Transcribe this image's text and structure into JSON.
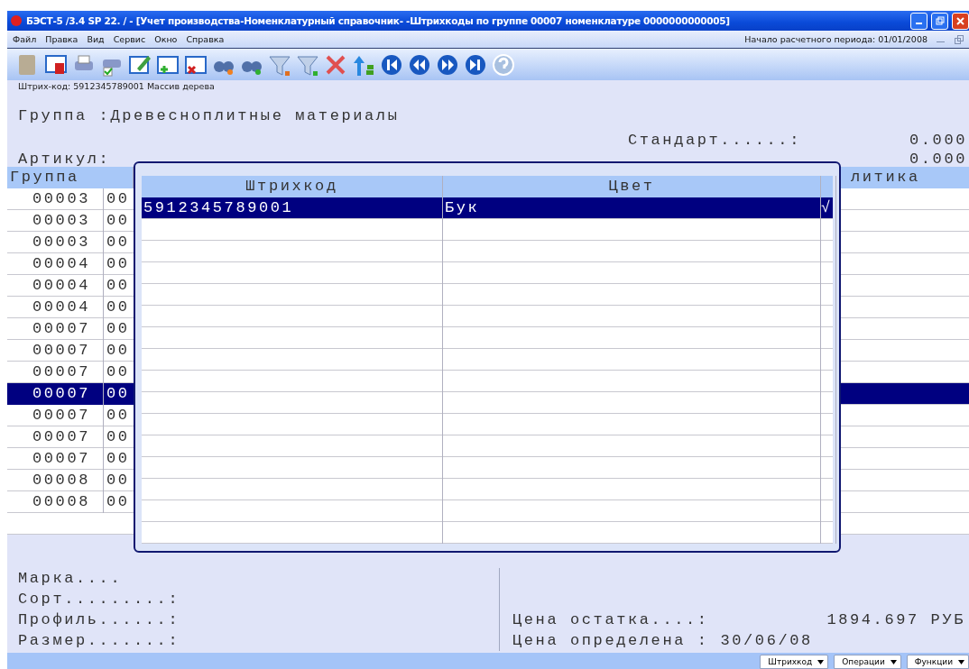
{
  "window": {
    "title": "БЭСТ-5 /3.4 SP 22. / - [Учет производства-Номенклатурный справочник- -Штрихкоды по группе 00007 номенклатуре 0000000000005]"
  },
  "menu": [
    "Файл",
    "Правка",
    "Вид",
    "Сервис",
    "Окно",
    "Справка"
  ],
  "period": "Начало расчетного периода: 01/01/2008",
  "hint": "Штрих-код: 5912345789001 Массив дерева",
  "header": {
    "group": "Группа :Древесноплитные материалы",
    "standard_label": "Стандарт......:",
    "standard_value": "0.000",
    "article_label": "Артикул:",
    "article_value": "0.000"
  },
  "table": {
    "column_1": "Группа",
    "column_3": "литика",
    "rows": [
      {
        "group": "00003",
        "column_2": "00",
        "selected": false
      },
      {
        "group": "00003",
        "column_2": "00",
        "selected": false
      },
      {
        "group": "00003",
        "column_2": "00",
        "selected": false
      },
      {
        "group": "00004",
        "column_2": "00",
        "selected": false
      },
      {
        "group": "00004",
        "column_2": "00",
        "selected": false
      },
      {
        "group": "00004",
        "column_2": "00",
        "selected": false
      },
      {
        "group": "00007",
        "column_2": "00",
        "selected": false
      },
      {
        "group": "00007",
        "column_2": "00",
        "selected": false
      },
      {
        "group": "00007",
        "column_2": "00",
        "selected": false
      },
      {
        "group": "00007",
        "column_2": "00",
        "selected": true
      },
      {
        "group": "00007",
        "column_2": "00",
        "selected": false
      },
      {
        "group": "00007",
        "column_2": "00",
        "selected": false
      },
      {
        "group": "00007",
        "column_2": "00",
        "selected": false
      },
      {
        "group": "00008",
        "column_2": "00",
        "selected": false
      },
      {
        "group": "00008",
        "column_2": "00",
        "selected": false
      }
    ]
  },
  "dialog": {
    "columns": [
      "Штрихкод",
      "Цвет"
    ],
    "rows": [
      {
        "barcode": "5912345789001",
        "color_name": "Бук",
        "mark": "√",
        "selected": true
      }
    ]
  },
  "details": {
    "left": [
      "Марка....",
      "Сорт.........:",
      "Профиль......:",
      "Размер.......:"
    ],
    "price_label": "Цена остатка....:",
    "price_value": "1894.697 РУБ",
    "date_line": "Цена определена : 30/06/08"
  },
  "bottom_buttons": [
    "Штрихкод",
    "Операции",
    "Функции"
  ]
}
